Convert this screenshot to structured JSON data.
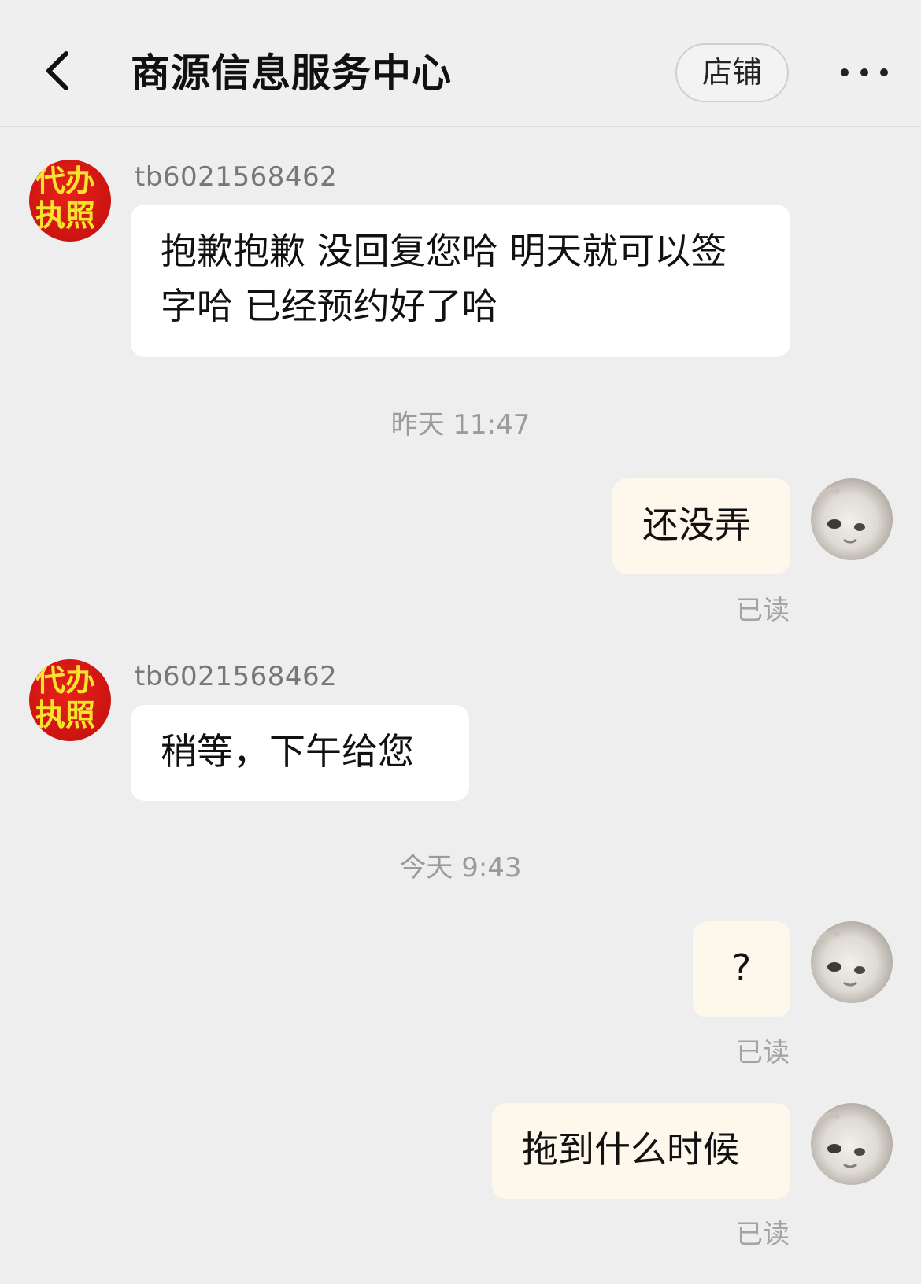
{
  "header": {
    "title": "商源信息服务中心",
    "shop_label": "店铺"
  },
  "messages": [
    {
      "sender": "shop",
      "nick": "tb6021568462",
      "avatar_text": [
        "代办",
        "执照"
      ],
      "text": "抱歉抱歉   没回复您哈    明天就可以签字哈     已经预约好了哈"
    },
    {
      "type": "time",
      "text": "昨天 11:47"
    },
    {
      "sender": "me",
      "text": "还没弄",
      "status": "已读"
    },
    {
      "sender": "shop",
      "nick": "tb6021568462",
      "avatar_text": [
        "代办",
        "执照"
      ],
      "text": "稍等，下午给您"
    },
    {
      "type": "time",
      "text": "今天 9:43"
    },
    {
      "sender": "me",
      "text": "?",
      "status": "已读"
    },
    {
      "sender": "me",
      "text": "拖到什么时候",
      "status": "已读"
    }
  ]
}
